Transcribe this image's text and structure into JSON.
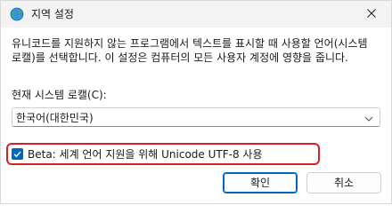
{
  "window": {
    "title": "지역 설정",
    "title_icon": "globe-icon",
    "close_icon": "close-icon"
  },
  "description": "유니코드를 지원하지 않는 프로그램에서 텍스트를 표시할 때 사용할 언어(시스템 로캘)를 선택합니다. 이 설정은 컴퓨터의 모든 사용자 계정에 영향을 줍니다.",
  "current_locale": {
    "label": "현재 시스템 로캘(C):",
    "value": "한국어(대한민국)",
    "dropdown_icon": "chevron-down-icon"
  },
  "beta_option": {
    "label": "Beta: 세계 언어 지원을 위해 Unicode UTF-8 사용",
    "checked": true,
    "highlight_color": "#d81f26"
  },
  "buttons": {
    "ok": "확인",
    "cancel": "취소"
  },
  "colors": {
    "accent": "#0067c0",
    "titlebar": "#f3f3f3"
  }
}
